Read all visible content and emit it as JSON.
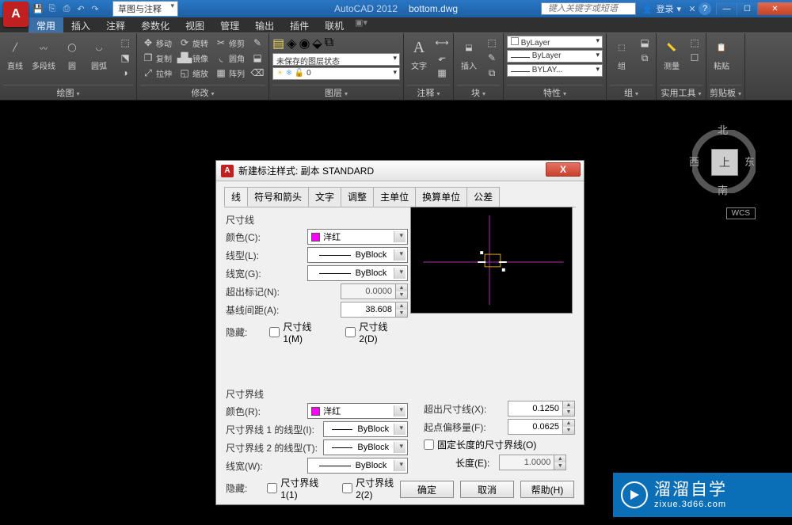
{
  "titlebar": {
    "workspace": "草图与注释",
    "app": "AutoCAD 2012",
    "file": "bottom.dwg",
    "search_placeholder": "键入关键字或短语",
    "login": "登录"
  },
  "menu": {
    "items": [
      "常用",
      "插入",
      "注释",
      "参数化",
      "视图",
      "管理",
      "输出",
      "插件",
      "联机"
    ],
    "active_index": 0
  },
  "ribbon": {
    "draw": {
      "label": "绘图",
      "btns": [
        "直线",
        "多段线",
        "圆",
        "圆弧"
      ]
    },
    "modify": {
      "label": "修改",
      "rows": [
        [
          "移动",
          "旋转",
          "修剪"
        ],
        [
          "复制",
          "镜像",
          "圆角"
        ],
        [
          "拉伸",
          "缩放",
          "阵列"
        ]
      ]
    },
    "layer": {
      "label": "图层",
      "unsaved": "未保存的图层状态",
      "current": "0"
    },
    "annotation": {
      "label": "注释",
      "btn": "文字"
    },
    "block": {
      "label": "块",
      "btn": "插入"
    },
    "properties": {
      "label": "特性",
      "rows": [
        "ByLayer",
        "ByLayer",
        "BYLAY..."
      ]
    },
    "group": {
      "label": "组",
      "btn": "组"
    },
    "utilities": {
      "label": "实用工具",
      "btn": "测量"
    },
    "clipboard": {
      "label": "剪贴板",
      "btn": "粘贴"
    }
  },
  "viewcube": {
    "n": "北",
    "s": "南",
    "e": "东",
    "w": "西",
    "top": "上",
    "wcs": "WCS"
  },
  "dialog": {
    "title": "新建标注样式: 副本 STANDARD",
    "tabs": [
      "线",
      "符号和箭头",
      "文字",
      "调整",
      "主单位",
      "换算单位",
      "公差"
    ],
    "active_tab": 0,
    "dimline": {
      "legend": "尺寸线",
      "color_label": "颜色(C):",
      "color_value": "洋红",
      "linetype_label": "线型(L):",
      "linetype_value": "ByBlock",
      "lineweight_label": "线宽(G):",
      "lineweight_value": "ByBlock",
      "extend_label": "超出标记(N):",
      "extend_value": "0.0000",
      "spacing_label": "基线间距(A):",
      "spacing_value": "38.608",
      "hide_label": "隐藏:",
      "hide1": "尺寸线 1(M)",
      "hide2": "尺寸线 2(D)"
    },
    "extline": {
      "legend": "尺寸界线",
      "color_label": "颜色(R):",
      "color_value": "洋红",
      "lt1_label": "尺寸界线 1 的线型(I):",
      "lt1_value": "ByBlock",
      "lt2_label": "尺寸界线 2 的线型(T):",
      "lt2_value": "ByBlock",
      "lineweight_label": "线宽(W):",
      "lineweight_value": "ByBlock",
      "hide_label": "隐藏:",
      "hide1": "尺寸界线 1(1)",
      "hide2": "尺寸界线 2(2)",
      "beyond_label": "超出尺寸线(X):",
      "beyond_value": "0.1250",
      "offset_label": "起点偏移量(F):",
      "offset_value": "0.0625",
      "fixed_label": "固定长度的尺寸界线(O)",
      "length_label": "长度(E):",
      "length_value": "1.0000"
    },
    "buttons": {
      "ok": "确定",
      "cancel": "取消",
      "help": "帮助(H)"
    }
  },
  "watermark": {
    "big": "溜溜自学",
    "small": "zixue.3d66.com"
  }
}
